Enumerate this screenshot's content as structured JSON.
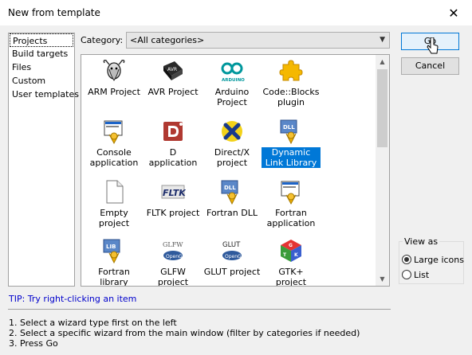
{
  "window": {
    "title": "New from template"
  },
  "sidebar": {
    "items": [
      {
        "label": "Projects",
        "selected": true
      },
      {
        "label": "Build targets"
      },
      {
        "label": "Files"
      },
      {
        "label": "Custom"
      },
      {
        "label": "User templates"
      }
    ]
  },
  "category": {
    "label": "Category:",
    "value": "<All categories>"
  },
  "templates": [
    {
      "label": "ARM Project",
      "icon": "gnu-icon"
    },
    {
      "label": "AVR Project",
      "icon": "avr-chip-icon"
    },
    {
      "label": "Arduino Project",
      "icon": "arduino-icon"
    },
    {
      "label": "Code::Blocks plugin",
      "icon": "puzzle-icon"
    },
    {
      "label": "Console application",
      "icon": "console-icon"
    },
    {
      "label": "D application",
      "icon": "d-lang-icon"
    },
    {
      "label": "Direct/X project",
      "icon": "directx-icon"
    },
    {
      "label": "Dynamic Link Library",
      "icon": "dll-icon",
      "selected": true
    },
    {
      "label": "Empty project",
      "icon": "blank-file-icon"
    },
    {
      "label": "FLTK project",
      "icon": "fltk-icon"
    },
    {
      "label": "Fortran DLL",
      "icon": "dll-icon"
    },
    {
      "label": "Fortran application",
      "icon": "monitor-icon"
    },
    {
      "label": "Fortran library",
      "icon": "lib-icon"
    },
    {
      "label": "GLFW project",
      "icon": "glfw-icon"
    },
    {
      "label": "GLUT project",
      "icon": "glut-icon"
    },
    {
      "label": "GTK+ project",
      "icon": "gtk-icon"
    }
  ],
  "tip": "TIP: Try right-clicking an item",
  "instructions": [
    "1. Select a wizard type first on the left",
    "2. Select a specific wizard from the main window (filter by categories if needed)",
    "3. Press Go"
  ],
  "buttons": {
    "go": "Go",
    "cancel": "Cancel"
  },
  "view_as": {
    "legend": "View as",
    "options": [
      {
        "label": "Large icons",
        "checked": true
      },
      {
        "label": "List",
        "checked": false
      }
    ]
  },
  "colors": {
    "selection": "#0078d7",
    "tip": "#0000cc"
  }
}
